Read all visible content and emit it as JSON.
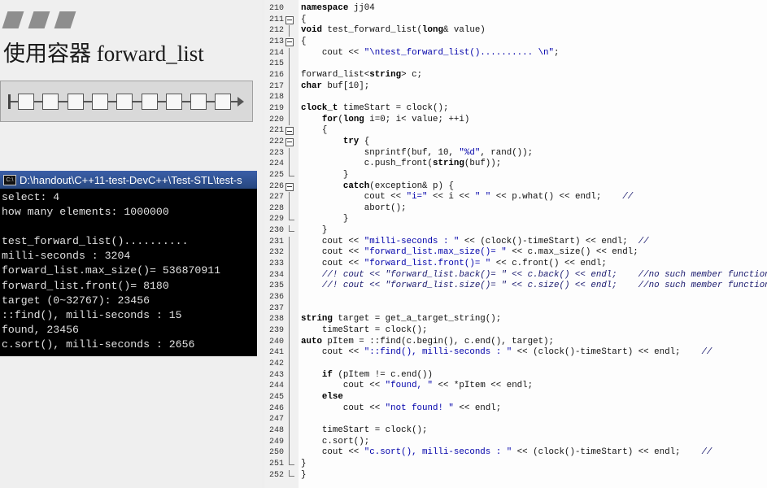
{
  "slide": {
    "title": "使用容器 forward_list",
    "node_count": 9
  },
  "console": {
    "title": "D:\\handout\\C++11-test-DevC++\\Test-STL\\test-s",
    "lines": [
      "select: 4",
      "how many elements: 1000000",
      "",
      "test_forward_list()..........",
      "milli-seconds : 3204",
      "forward_list.max_size()= 536870911",
      "forward_list.front()= 8180",
      "target (0~32767): 23456",
      "::find(), milli-seconds : 15",
      "found, 23456",
      "c.sort(), milli-seconds : 2656"
    ]
  },
  "editor": {
    "lines": [
      {
        "n": "210",
        "fold": "none",
        "text": "namespace jj04"
      },
      {
        "n": "211",
        "fold": "open",
        "text": "{"
      },
      {
        "n": "212",
        "fold": "tick",
        "text": "void test_forward_list(long& value)"
      },
      {
        "n": "213",
        "fold": "open",
        "text": "{"
      },
      {
        "n": "214",
        "fold": "tick",
        "text": "    cout << \"\\ntest_forward_list().......... \\n\";"
      },
      {
        "n": "215",
        "fold": "tick",
        "text": ""
      },
      {
        "n": "216",
        "fold": "tick",
        "text": "forward_list<string> c;"
      },
      {
        "n": "217",
        "fold": "tick",
        "text": "char buf[10];"
      },
      {
        "n": "218",
        "fold": "tick",
        "text": ""
      },
      {
        "n": "219",
        "fold": "tick",
        "text": "clock_t timeStart = clock();"
      },
      {
        "n": "220",
        "fold": "tick",
        "text": "    for(long i=0; i< value; ++i)"
      },
      {
        "n": "221",
        "fold": "open",
        "text": "    {"
      },
      {
        "n": "222",
        "fold": "open",
        "text": "        try {"
      },
      {
        "n": "223",
        "fold": "tick",
        "text": "            snprintf(buf, 10, \"%d\", rand());"
      },
      {
        "n": "224",
        "fold": "tick",
        "text": "            c.push_front(string(buf));"
      },
      {
        "n": "225",
        "fold": "end",
        "text": "        }"
      },
      {
        "n": "226",
        "fold": "open",
        "text": "        catch(exception& p) {"
      },
      {
        "n": "227",
        "fold": "tick",
        "text": "            cout << \"i=\" << i << \" \" << p.what() << endl;    //"
      },
      {
        "n": "228",
        "fold": "tick",
        "text": "            abort();"
      },
      {
        "n": "229",
        "fold": "end",
        "text": "        }"
      },
      {
        "n": "230",
        "fold": "end",
        "text": "    }"
      },
      {
        "n": "231",
        "fold": "tick",
        "text": "    cout << \"milli-seconds : \" << (clock()-timeStart) << endl;  //"
      },
      {
        "n": "232",
        "fold": "tick",
        "text": "    cout << \"forward_list.max_size()= \" << c.max_size() << endl;"
      },
      {
        "n": "233",
        "fold": "tick",
        "text": "    cout << \"forward_list.front()= \" << c.front() << endl;"
      },
      {
        "n": "234",
        "fold": "tick",
        "text": "    //! cout << \"forward_list.back()= \" << c.back() << endl;    //no such member function"
      },
      {
        "n": "235",
        "fold": "tick",
        "text": "    //! cout << \"forward_list.size()= \" << c.size() << endl;    //no such member function"
      },
      {
        "n": "236",
        "fold": "tick",
        "text": ""
      },
      {
        "n": "237",
        "fold": "tick",
        "text": ""
      },
      {
        "n": "238",
        "fold": "tick",
        "text": "string target = get_a_target_string();"
      },
      {
        "n": "239",
        "fold": "tick",
        "text": "    timeStart = clock();"
      },
      {
        "n": "240",
        "fold": "tick",
        "text": "auto pItem = ::find(c.begin(), c.end(), target);"
      },
      {
        "n": "241",
        "fold": "tick",
        "text": "    cout << \"::find(), milli-seconds : \" << (clock()-timeStart) << endl;    //"
      },
      {
        "n": "242",
        "fold": "tick",
        "text": ""
      },
      {
        "n": "243",
        "fold": "tick",
        "text": "    if (pItem != c.end())"
      },
      {
        "n": "244",
        "fold": "tick",
        "text": "        cout << \"found, \" << *pItem << endl;"
      },
      {
        "n": "245",
        "fold": "tick",
        "text": "    else"
      },
      {
        "n": "246",
        "fold": "tick",
        "text": "        cout << \"not found! \" << endl;"
      },
      {
        "n": "247",
        "fold": "tick",
        "text": ""
      },
      {
        "n": "248",
        "fold": "tick",
        "text": "    timeStart = clock();"
      },
      {
        "n": "249",
        "fold": "tick",
        "text": "    c.sort();"
      },
      {
        "n": "250",
        "fold": "tick",
        "text": "    cout << \"c.sort(), milli-seconds : \" << (clock()-timeStart) << endl;    //"
      },
      {
        "n": "251",
        "fold": "end",
        "text": "}"
      },
      {
        "n": "252",
        "fold": "end",
        "text": "}"
      }
    ]
  }
}
